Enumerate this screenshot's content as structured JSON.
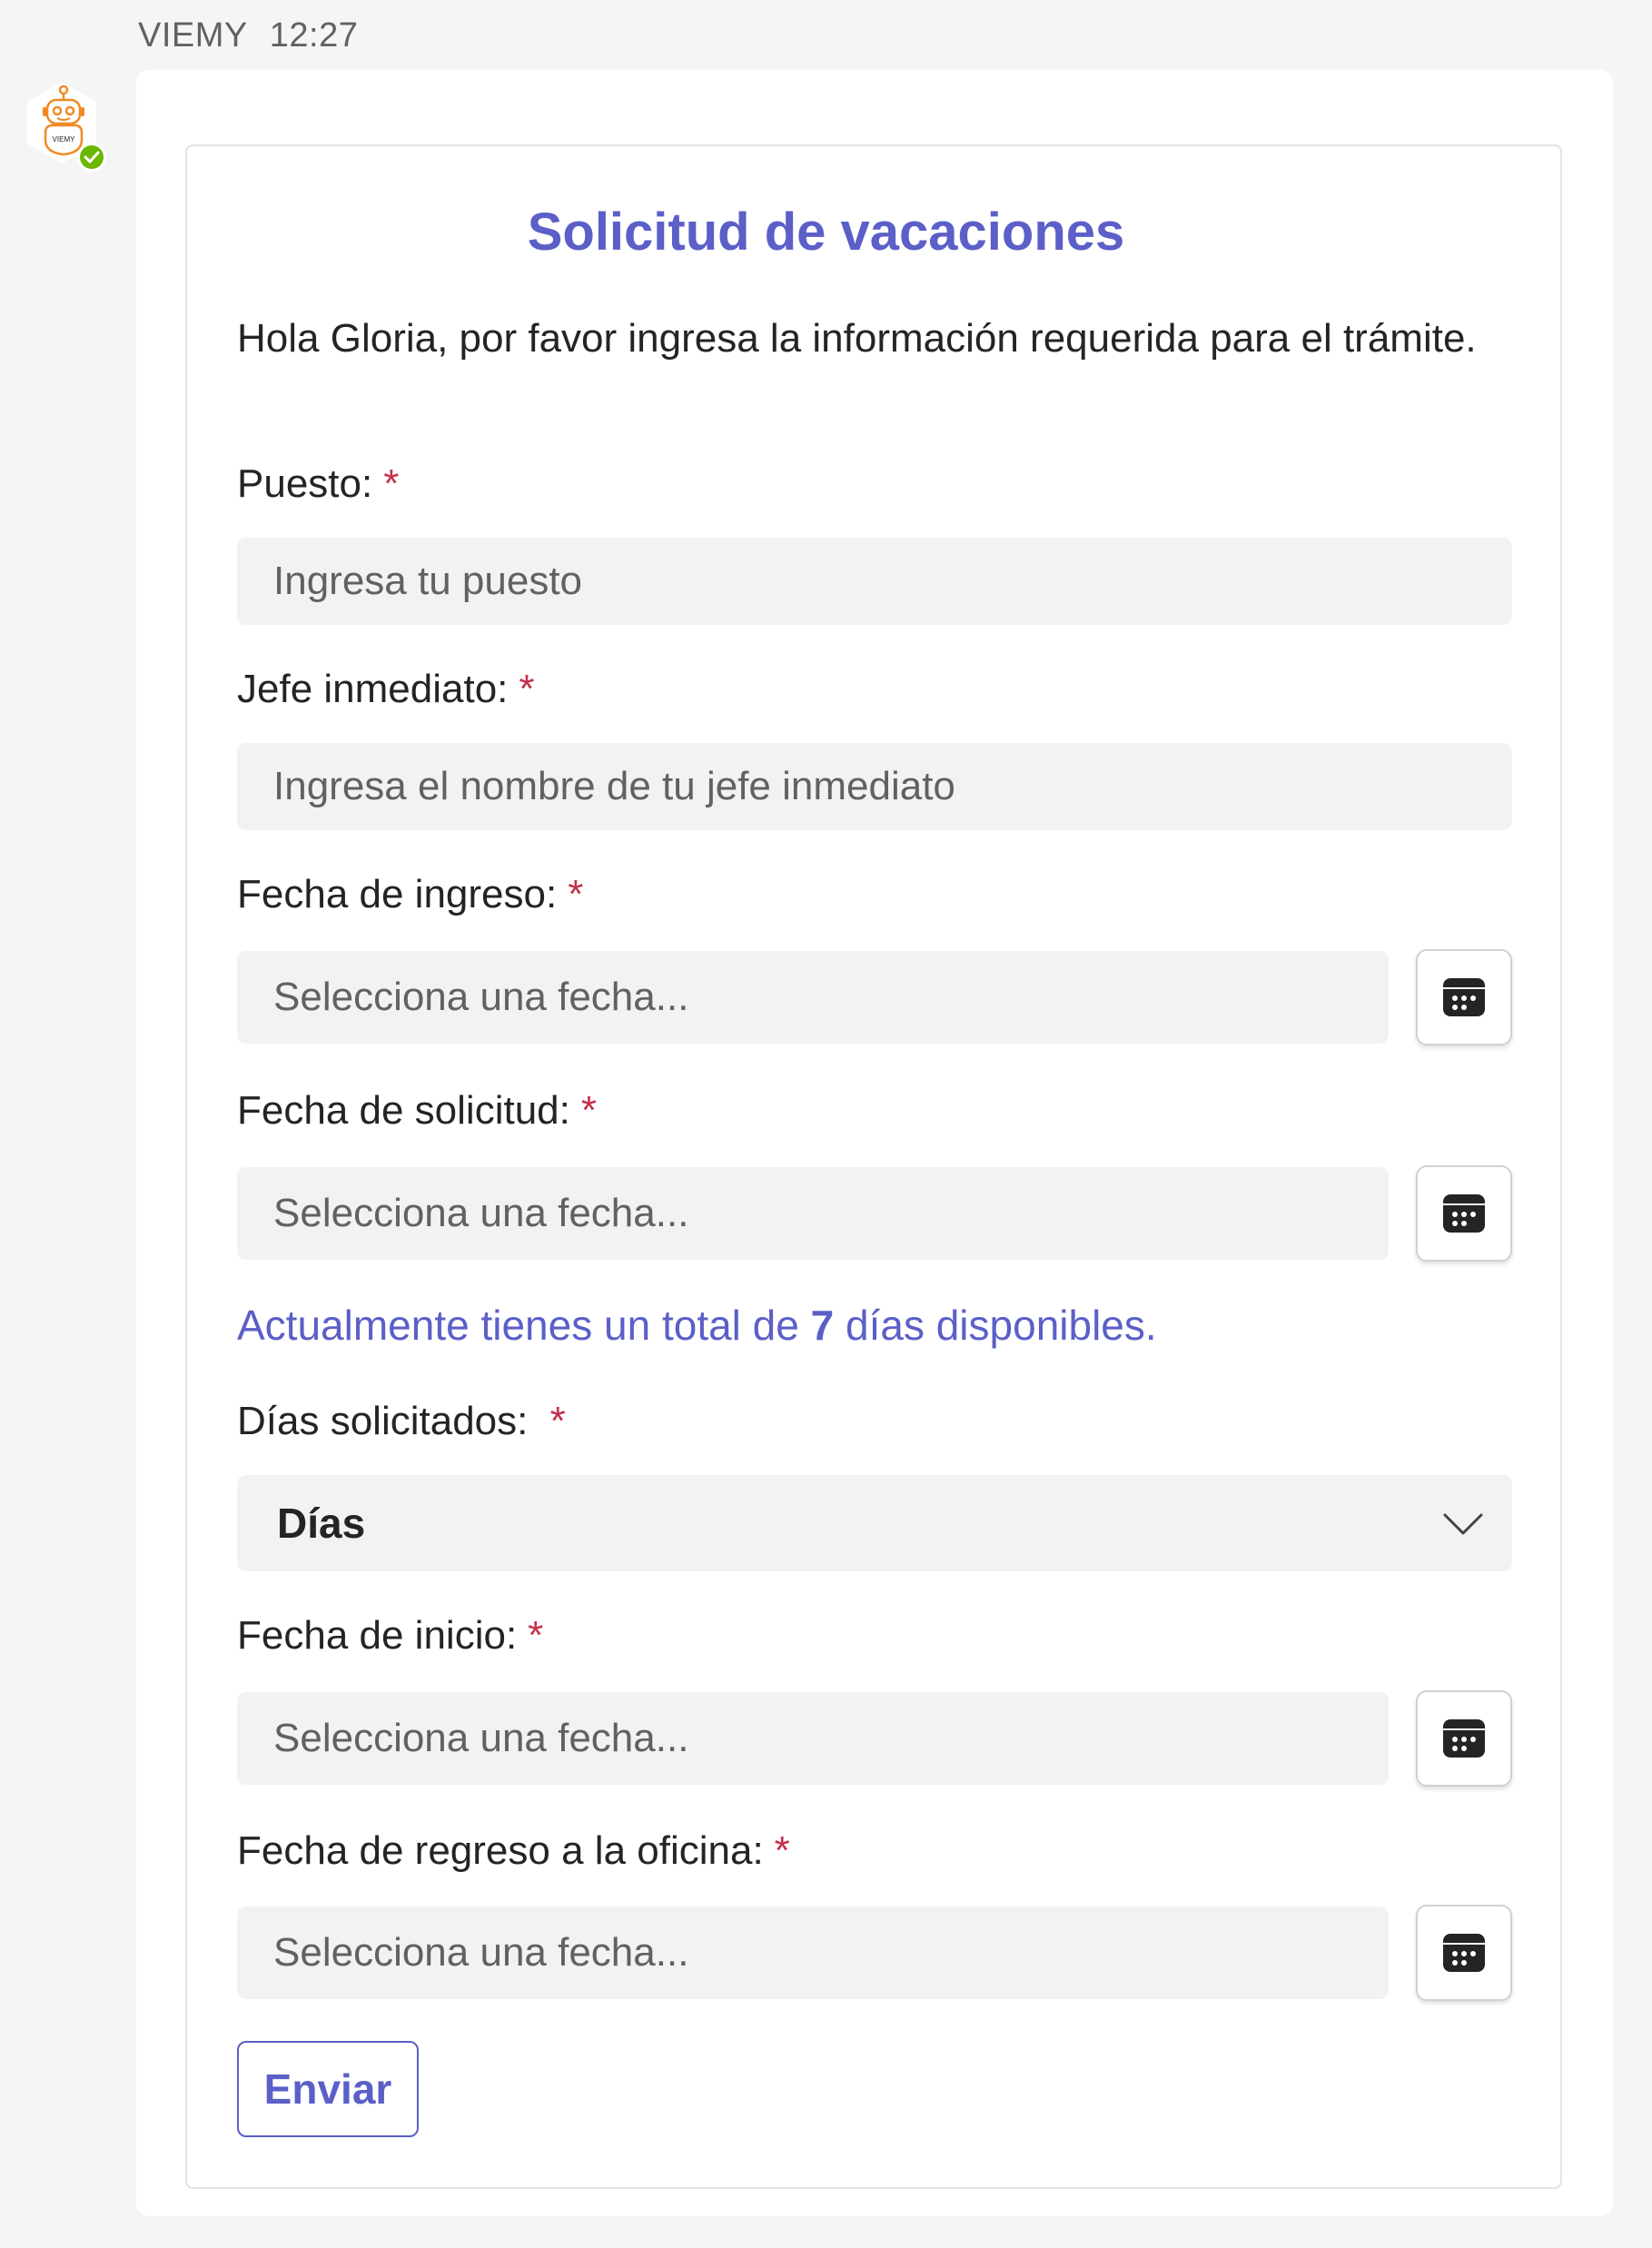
{
  "message": {
    "sender": "VIEMY",
    "time": "12:27",
    "avatar_text": "VIEMY"
  },
  "form": {
    "title": "Solicitud de vacaciones",
    "intro": "Hola Gloria, por favor ingresa la información requerida para el trámite.",
    "required_mark": "*",
    "fields": {
      "puesto": {
        "label": "Puesto:",
        "placeholder": "Ingresa tu puesto"
      },
      "jefe": {
        "label": "Jefe inmediato:",
        "placeholder": "Ingresa el nombre de tu jefe inmediato"
      },
      "fecha_ingreso": {
        "label": "Fecha de ingreso:",
        "placeholder": "Selecciona una fecha..."
      },
      "fecha_solicitud": {
        "label": "Fecha de solicitud:",
        "placeholder": "Selecciona una fecha..."
      },
      "dias_solicitados": {
        "label": "Días solicitados:",
        "selected": "Días"
      },
      "fecha_inicio": {
        "label": "Fecha de inicio:",
        "placeholder": "Selecciona una fecha..."
      },
      "fecha_regreso": {
        "label": "Fecha de regreso a la oficina:",
        "placeholder": "Selecciona una fecha..."
      }
    },
    "availability": {
      "prefix": "Actualmente tienes un total de",
      "days": "7",
      "suffix": "días disponibles."
    },
    "submit_label": "Enviar"
  },
  "colors": {
    "accent": "#5b5fc7",
    "required": "#c4314b",
    "status_online": "#6bb700",
    "bot_orange": "#f08a24"
  },
  "icons": [
    "bot-avatar-icon",
    "status-available-icon",
    "calendar-icon",
    "chevron-down-icon"
  ]
}
